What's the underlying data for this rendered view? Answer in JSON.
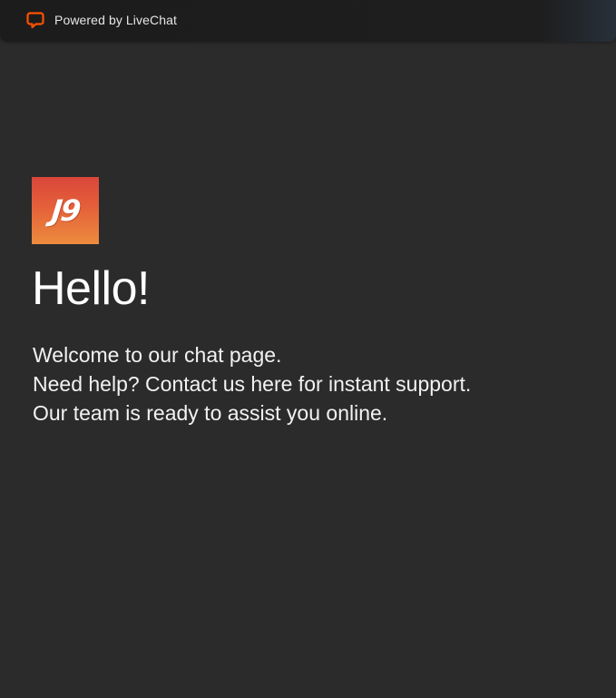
{
  "header": {
    "powered_by_label": "Powered by LiveChat",
    "icon": "livechat-icon",
    "accent_color": "#ff5100"
  },
  "brand": {
    "logo_text": "J9",
    "logo_colors": [
      "#d9463a",
      "#ec8c3e"
    ]
  },
  "main": {
    "greeting": "Hello!",
    "welcome_lines": [
      "Welcome to our chat page.",
      "Need help? Contact us here for instant support.",
      "Our team is ready to assist you online."
    ]
  },
  "theme": {
    "background": "#2b2b2b",
    "text_color": "#ffffff"
  }
}
